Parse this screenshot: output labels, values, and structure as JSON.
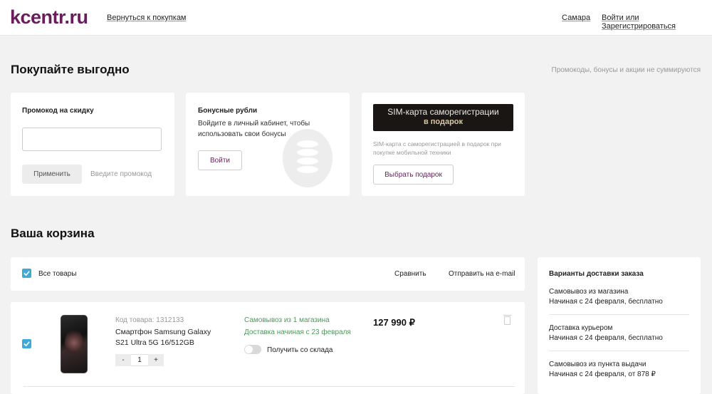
{
  "header": {
    "logo": "kcentr.ru",
    "back_link": "Вернуться к покупкам",
    "city": "Самара",
    "login": "Войти или Зарегистрироваться"
  },
  "promo_section": {
    "title": "Покупайте выгодно",
    "note": "Промокоды, бонусы и акции не суммируются",
    "promo_card": {
      "title": "Промокод на скидку",
      "input_value": "",
      "apply_button": "Применить",
      "hint": "Введите промокод"
    },
    "bonus_card": {
      "title": "Бонусные рубли",
      "text": "Войдите в личный кабинет, чтобы использовать свои бонусы",
      "login_button": "Войти"
    },
    "gift_card": {
      "banner_line1": "SIM-карта саморегистрации",
      "banner_line2": "в подарок",
      "text": "SIM-карта с саморегистрацией в подарок при покупке мобильной техники",
      "choose_button": "Выбрать подарок"
    }
  },
  "cart": {
    "title": "Ваша корзина",
    "select_all": "Все товары",
    "compare": "Сравнить",
    "send_email": "Отправить на e-mail",
    "items": [
      {
        "code": "Код товара: 1312133",
        "name": "Смартфон Samsung Galaxy S21 Ultra 5G 16/512GB",
        "quantity": "1",
        "minus": "-",
        "plus": "+",
        "pickup": "Самовывоз из 1 магазина",
        "delivery": "Доставка начиная с 23 февраля",
        "warehouse_toggle": "Получить со склада",
        "price": "127 990 ₽"
      }
    ]
  },
  "delivery": {
    "title": "Варианты доставки заказа",
    "options": [
      {
        "name": "Самовывоз из магазина",
        "detail": "Начиная с 24 февраля, бесплатно"
      },
      {
        "name": "Доставка курьером",
        "detail": "Начиная с 24 февраля, бесплатно"
      },
      {
        "name": "Самовывоз из пункта выдачи",
        "detail": "Начиная с 24 февраля, от 878 ₽"
      }
    ]
  },
  "colors": {
    "brand": "#6a1c5b",
    "checkbox": "#3fa9d8",
    "green": "#4a9a5a"
  }
}
